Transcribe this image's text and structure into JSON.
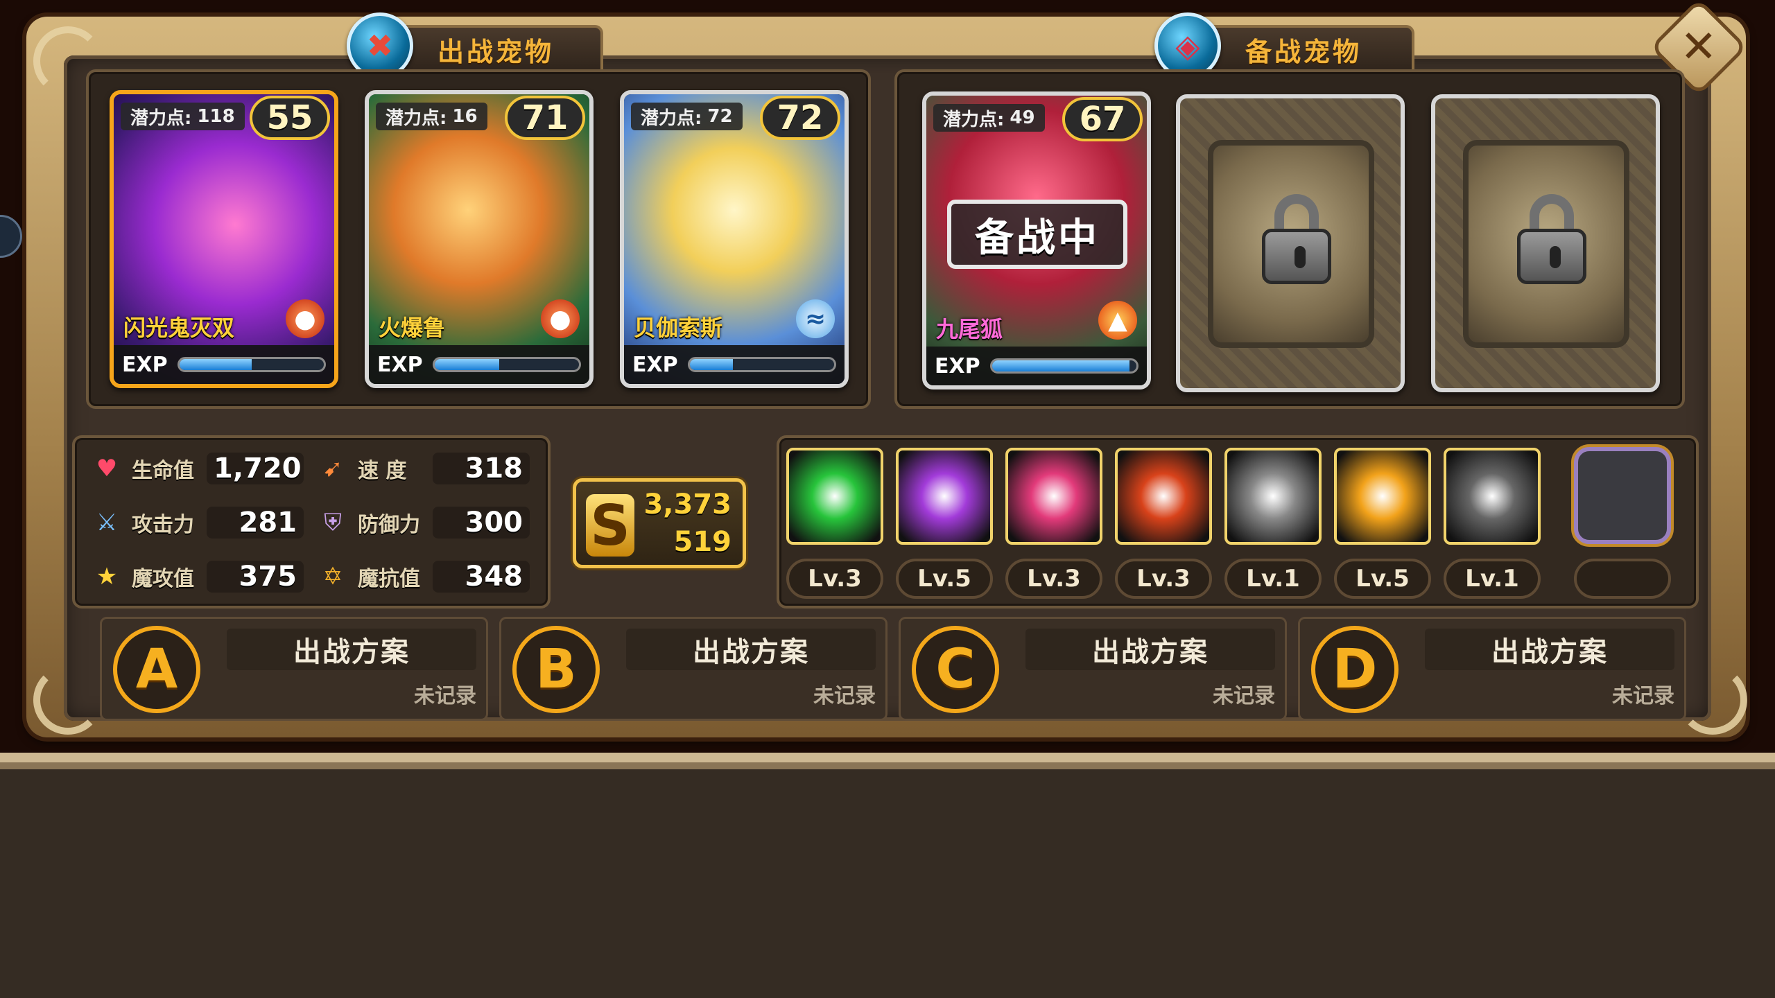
{
  "tabs": {
    "battle": {
      "label": "出战宠物",
      "icon": "battle-icon"
    },
    "reserve": {
      "label": "备战宠物",
      "icon": "shield-icon"
    }
  },
  "close_icon": "close-icon",
  "battle_pets": [
    {
      "name": "闪光鬼灭双",
      "potential_label": "潜力点:",
      "potential": "118",
      "level": "55",
      "exp_label": "EXP",
      "exp": 0.5,
      "element": "fire",
      "selected": true
    },
    {
      "name": "火爆鲁",
      "potential_label": "潜力点:",
      "potential": "16",
      "level": "71",
      "exp_label": "EXP",
      "exp": 0.45,
      "element": "fire",
      "selected": false
    },
    {
      "name": "贝伽索斯",
      "potential_label": "潜力点:",
      "potential": "72",
      "level": "72",
      "exp_label": "EXP",
      "exp": 0.3,
      "element": "wind",
      "selected": false
    }
  ],
  "reserve_pets": [
    {
      "name": "九尾狐",
      "potential_label": "潜力点:",
      "potential": "49",
      "level": "67",
      "exp_label": "EXP",
      "exp": 0.95,
      "element": "fire",
      "stamp": "备战中"
    },
    {
      "locked": true,
      "icon": "lock-icon"
    },
    {
      "locked": true,
      "icon": "lock-icon"
    }
  ],
  "stats": {
    "hp": {
      "label": "生命值",
      "value": "1,720",
      "icon": "heart-icon"
    },
    "speed": {
      "label": "速 度",
      "value": "318",
      "icon": "boot-icon"
    },
    "attack": {
      "label": "攻击力",
      "value": "281",
      "icon": "sword-icon"
    },
    "defense": {
      "label": "防御力",
      "value": "300",
      "icon": "shield-stat-icon"
    },
    "magic_attack": {
      "label": "魔攻值",
      "value": "375",
      "icon": "star-wand-icon"
    },
    "magic_resist": {
      "label": "魔抗值",
      "value": "348",
      "icon": "hexagram-icon"
    }
  },
  "money": {
    "icon": "coin-s-icon",
    "gold": "3,373",
    "silver": "519"
  },
  "skills": [
    {
      "level": "Lv.3",
      "icon": "green-burst-skill-icon",
      "color": "#27c43b"
    },
    {
      "level": "Lv.5",
      "icon": "purple-slash-skill-icon",
      "color": "#a23bd9"
    },
    {
      "level": "Lv.3",
      "icon": "pink-star-skill-icon",
      "color": "#e23a7a"
    },
    {
      "level": "Lv.3",
      "icon": "fire-beast-skill-icon",
      "color": "#d8421a"
    },
    {
      "level": "Lv.1",
      "icon": "gray-light-skill-icon",
      "color": "#888888"
    },
    {
      "level": "Lv.5",
      "icon": "sun-burst-skill-icon",
      "color": "#f2a21a"
    },
    {
      "level": "Lv.1",
      "icon": "dark-wings-skill-icon",
      "color": "#666666"
    }
  ],
  "empty_skill_slot": {
    "icon": "empty-slot-icon"
  },
  "plans": [
    {
      "letter": "A",
      "title": "出战方案",
      "status": "未记录"
    },
    {
      "letter": "B",
      "title": "出战方案",
      "status": "未记录"
    },
    {
      "letter": "C",
      "title": "出战方案",
      "status": "未记录"
    },
    {
      "letter": "D",
      "title": "出战方案",
      "status": "未记录"
    }
  ],
  "colors": {
    "accent": "#f4a81a",
    "gold_text": "#ffd23a",
    "exp_bar": "#1a7fd6"
  }
}
